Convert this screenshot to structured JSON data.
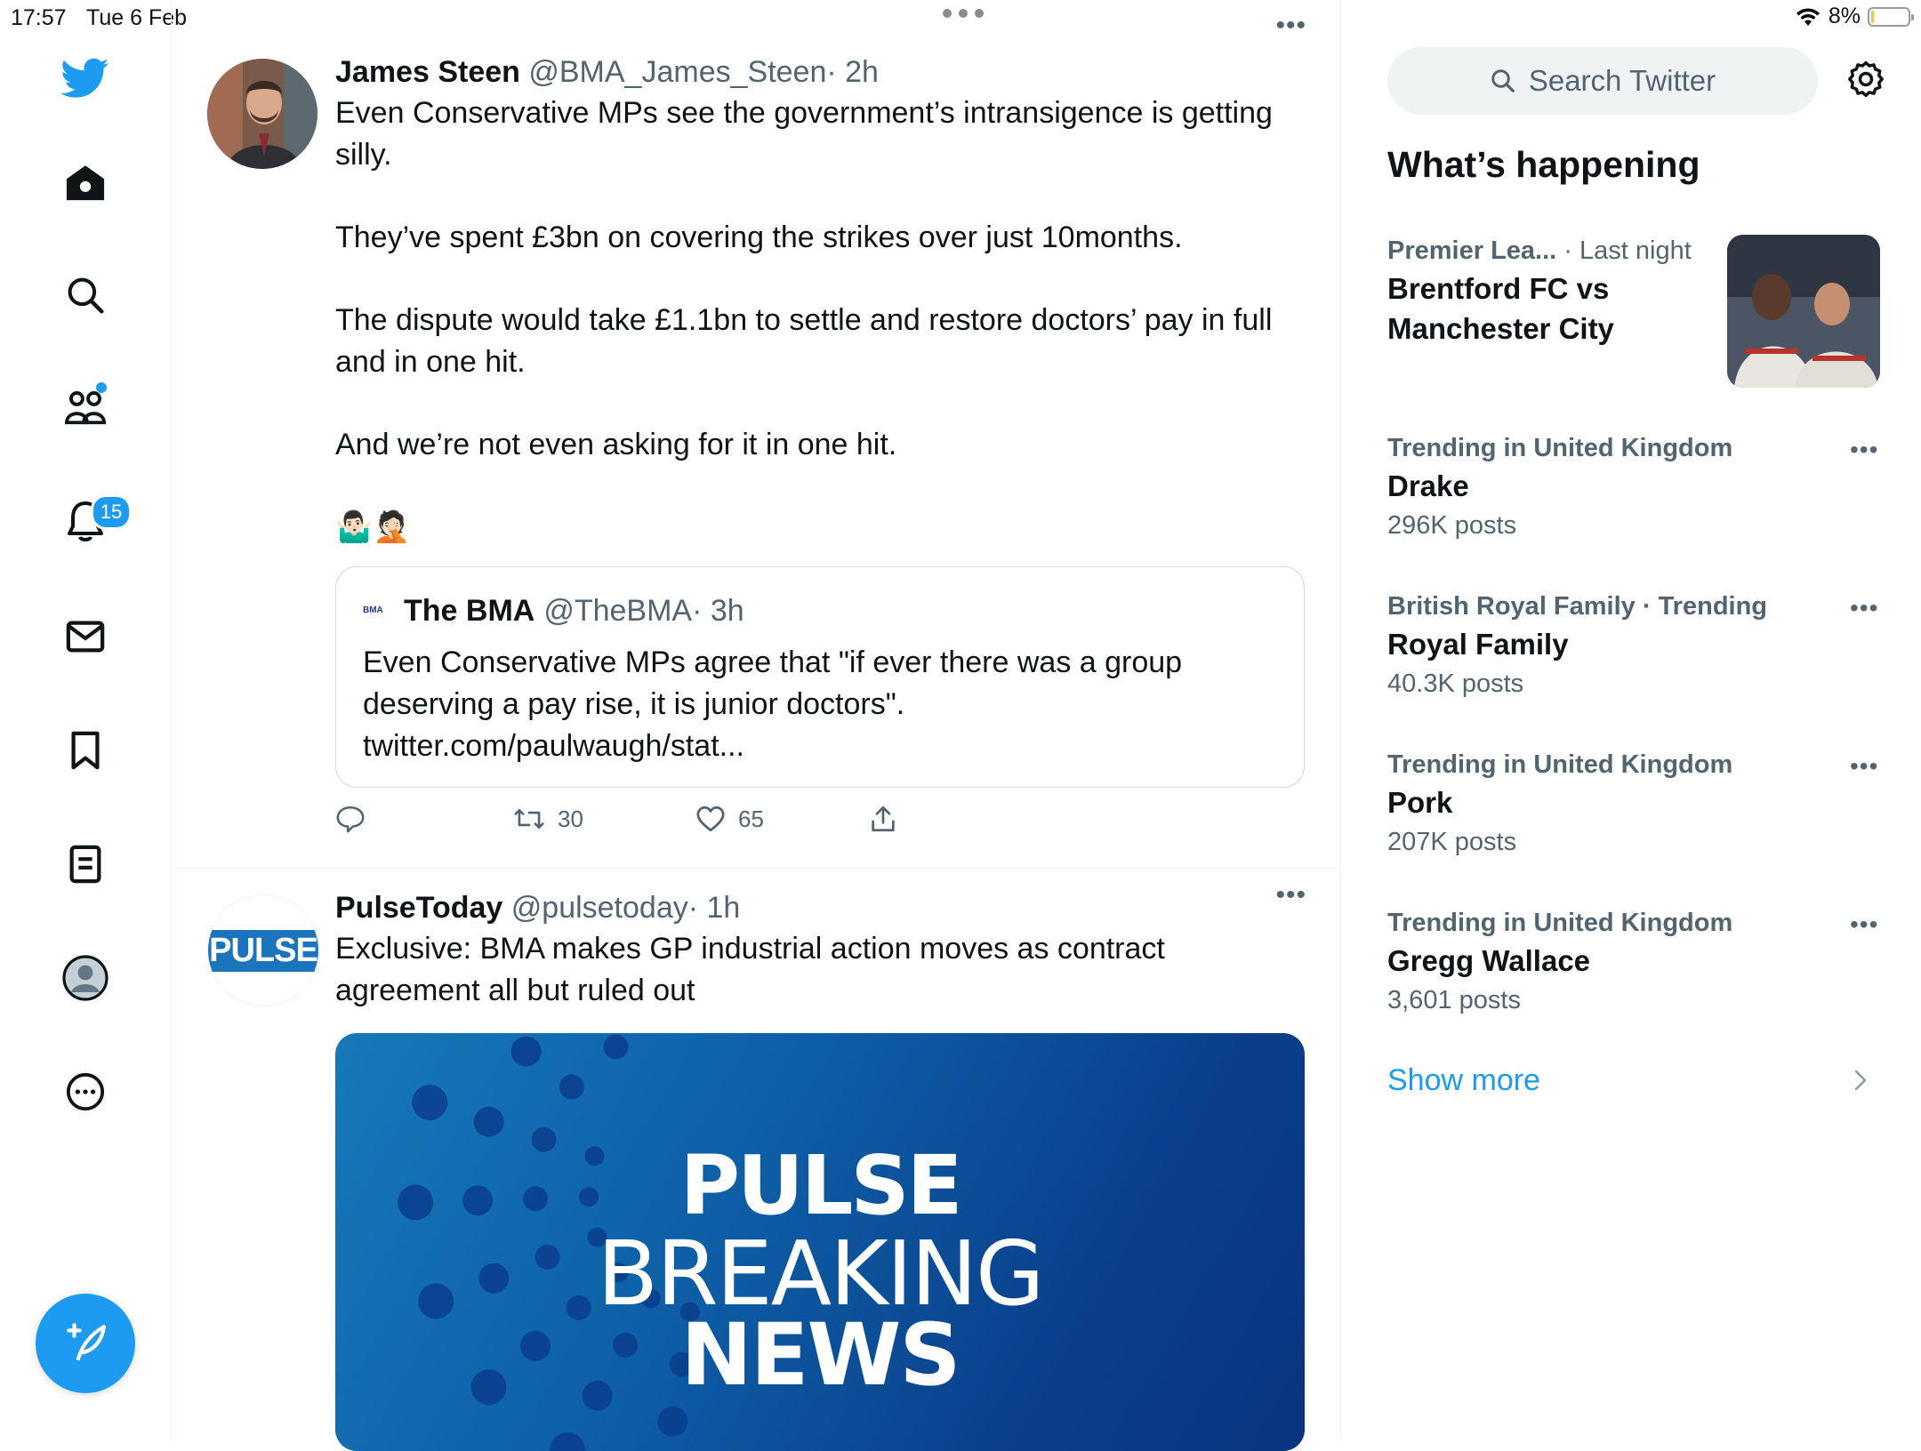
{
  "status": {
    "time": "17:57",
    "date": "Tue 6 Feb",
    "battery": "8%",
    "battery_level": 0.08
  },
  "nav": {
    "notifications_badge": "15",
    "items": [
      "twitter-logo",
      "home-icon",
      "search-icon",
      "communities-icon",
      "notifications-icon",
      "messages-icon",
      "bookmarks-icon",
      "lists-icon",
      "profile-icon",
      "more-icon"
    ]
  },
  "tweets": [
    {
      "name": "James Steen",
      "handle": "@BMA_James_Steen",
      "time": "· 2h",
      "paragraphs": [
        "Even Conservative MPs see the government’s intransigence is getting silly.",
        "They’ve spent £3bn on covering the strikes over just 10months.",
        "The dispute would take £1.1bn to settle and restore doctors’ pay in full and in one hit.",
        "And we’re not even asking for it in one hit.",
        "🤷🏻‍♂️🤦🏻"
      ],
      "quote": {
        "logo": "BMA",
        "name": "The BMA",
        "handle": "@TheBMA",
        "time": "· 3h",
        "text": "Even Conservative MPs agree that \"if ever there was a group deserving a pay rise, it is junior doctors\". twitter.com/paulwaugh/stat..."
      },
      "retweets": "30",
      "likes": "65"
    },
    {
      "name": "PulseToday",
      "handle": "@pulsetoday",
      "time": "· 1h",
      "avatar_text": "PULSE",
      "text": "Exclusive: BMA makes GP industrial action moves as contract agreement all but ruled out",
      "media": {
        "line1": "PULSE",
        "line2": "BREAKING",
        "line3": "NEWS"
      }
    }
  ],
  "sidebar": {
    "search_placeholder": "Search Twitter",
    "section_title": "What’s happening",
    "featured": {
      "category": "Premier Lea...",
      "time": "· Last night",
      "title": "Brentford FC vs Manchester City"
    },
    "trends": [
      {
        "context": "Trending in United Kingdom",
        "name": "Drake",
        "count": "296K posts"
      },
      {
        "context": "British Royal Family · Trending",
        "name": "Royal Family",
        "count": "40.3K posts"
      },
      {
        "context": "Trending in United Kingdom",
        "name": "Pork",
        "count": "207K posts"
      },
      {
        "context": "Trending in United Kingdom",
        "name": "Gregg Wallace",
        "count": "3,601 posts"
      }
    ],
    "show_more": "Show more"
  },
  "colors": {
    "accent": "#1d9bf0",
    "text": "#0f1419",
    "muted": "#536471",
    "border": "#eff3f4"
  }
}
